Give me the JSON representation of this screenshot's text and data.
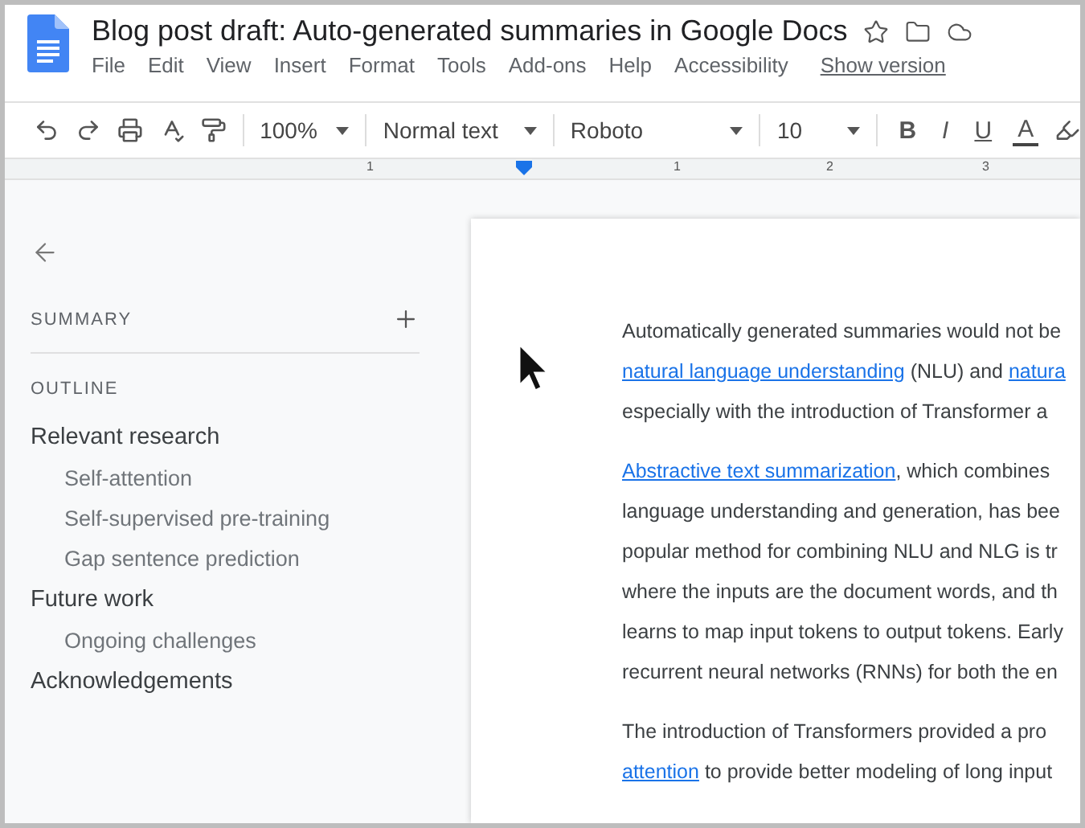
{
  "document": {
    "title": "Blog post draft: Auto-generated summaries in Google Docs"
  },
  "menu": [
    "File",
    "Edit",
    "View",
    "Insert",
    "Format",
    "Tools",
    "Add-ons",
    "Help",
    "Accessibility"
  ],
  "version_link": "Show version",
  "toolbar": {
    "zoom": "100%",
    "style": "Normal text",
    "font": "Roboto",
    "size": "10",
    "format_buttons": [
      "B",
      "I",
      "U",
      "A"
    ]
  },
  "ruler": [
    "1",
    "1",
    "2",
    "3"
  ],
  "sidebar": {
    "summary_heading": "SUMMARY",
    "outline_heading": "OUTLINE",
    "outline": [
      {
        "label": "Relevant research",
        "children": [
          {
            "label": "Self-attention"
          },
          {
            "label": "Self-supervised pre-training"
          },
          {
            "label": "Gap sentence prediction"
          }
        ]
      },
      {
        "label": "Future work",
        "children": [
          {
            "label": "Ongoing challenges"
          }
        ]
      },
      {
        "label": "Acknowledgements"
      }
    ]
  },
  "body": [
    [
      [
        {
          "kind": "text",
          "text": "Automatically generated summaries would not be"
        }
      ],
      [
        {
          "kind": "link",
          "text": "natural language understanding"
        },
        {
          "kind": "text",
          "text": " (NLU) and "
        },
        {
          "kind": "link",
          "text": "natura"
        }
      ],
      [
        {
          "kind": "text",
          "text": "especially with the introduction of Transformer a"
        }
      ]
    ],
    [
      [
        {
          "kind": "link",
          "text": "Abstractive text summarization"
        },
        {
          "kind": "text",
          "text": ", which combines"
        }
      ],
      [
        {
          "kind": "text",
          "text": "language understanding and generation, has bee"
        }
      ],
      [
        {
          "kind": "text",
          "text": "popular method for combining NLU and NLG is tr"
        }
      ],
      [
        {
          "kind": "text",
          "text": "where the inputs are the document words, and th"
        }
      ],
      [
        {
          "kind": "text",
          "text": "learns to map input tokens to output tokens. Early"
        }
      ],
      [
        {
          "kind": "text",
          "text": "recurrent neural networks (RNNs) for both the en"
        }
      ]
    ],
    [
      [
        {
          "kind": "text",
          "text": "The introduction of Transformers provided a pro"
        }
      ],
      [
        {
          "kind": "link",
          "text": "attention"
        },
        {
          "kind": "text",
          "text": " to provide better modeling of long input"
        }
      ]
    ]
  ]
}
